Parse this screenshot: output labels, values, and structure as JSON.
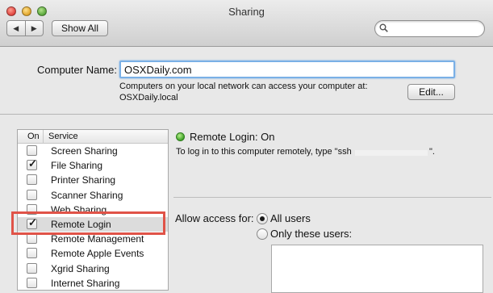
{
  "window": {
    "title": "Sharing"
  },
  "toolbar": {
    "back_glyph": "◀",
    "forward_glyph": "▶",
    "show_all_label": "Show All",
    "search_value": ""
  },
  "computer": {
    "name_label": "Computer Name:",
    "name_value": "OSXDaily.com",
    "info_line1": "Computers on your local network can access your computer at:",
    "info_line2": "OSXDaily.local",
    "edit_label": "Edit..."
  },
  "services": {
    "header_on": "On",
    "header_service": "Service",
    "items": [
      {
        "label": "Screen Sharing",
        "checked": false,
        "check": ""
      },
      {
        "label": "File Sharing",
        "checked": true,
        "check": "✓"
      },
      {
        "label": "Printer Sharing",
        "checked": false,
        "check": ""
      },
      {
        "label": "Scanner Sharing",
        "checked": false,
        "check": ""
      },
      {
        "label": "Web Sharing",
        "checked": false,
        "check": ""
      },
      {
        "label": "Remote Login",
        "checked": true,
        "check": "✓"
      },
      {
        "label": "Remote Management",
        "checked": false,
        "check": ""
      },
      {
        "label": "Remote Apple Events",
        "checked": false,
        "check": ""
      },
      {
        "label": "Xgrid Sharing",
        "checked": false,
        "check": ""
      },
      {
        "label": "Internet Sharing",
        "checked": false,
        "check": ""
      }
    ]
  },
  "detail": {
    "status": "Remote Login: On",
    "status_color": "#3ea127",
    "instruction_prefix": "To log in to this computer remotely, type \"ssh",
    "instruction_suffix": "\".",
    "access_label": "Allow access for:",
    "option_all": "All users",
    "option_these": "Only these users:"
  },
  "colors": {
    "highlight": "#e05348",
    "focus_ring": "#7ab0e6"
  }
}
